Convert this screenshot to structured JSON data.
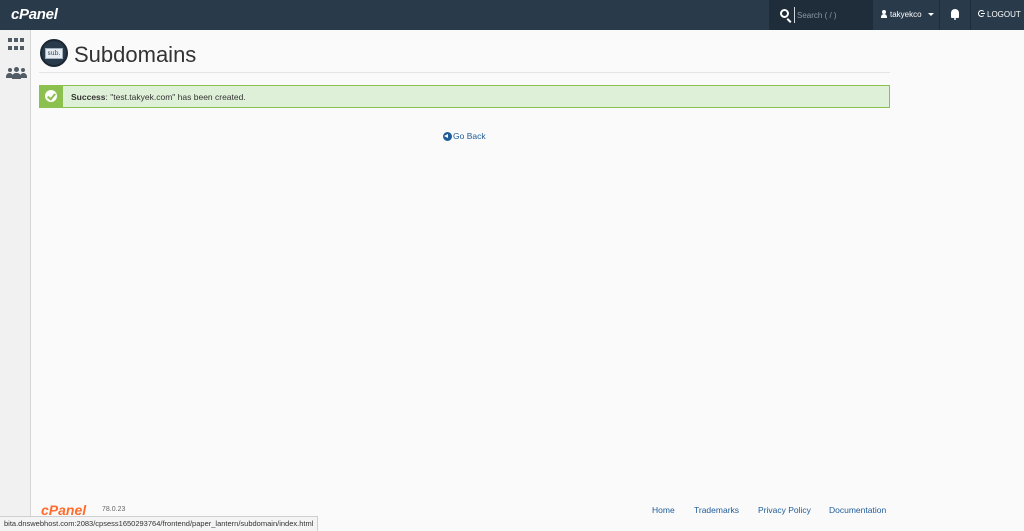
{
  "topbar": {
    "logo": "cPanel",
    "search_placeholder": "Search ( / )",
    "username": "takyekco",
    "logout_label": "LOGOUT"
  },
  "sidebar": {
    "items": [
      {
        "icon": "grid-icon",
        "label": "Home"
      },
      {
        "icon": "users-icon",
        "label": "User Manager"
      }
    ]
  },
  "header": {
    "page_icon_text": "sub.",
    "title": "Subdomains"
  },
  "alert": {
    "type": "success",
    "strong": "Success",
    "message": ": \"test.takyek.com\" has been created.",
    "icon": "check-icon"
  },
  "go_back": {
    "label": "Go Back",
    "icon": "arrow-circle-left-icon"
  },
  "footer": {
    "logo": "cPanel",
    "version": "78.0.23",
    "links": [
      "Home",
      "Trademarks",
      "Privacy Policy",
      "Documentation"
    ]
  },
  "status_bar": {
    "url": "bita.dnswebhost.com:2083/cpsess1650293764/frontend/paper_lantern/subdomain/index.html"
  },
  "colors": {
    "topbar": "#293a4a",
    "accent_orange": "#ff6c2c",
    "success_bg": "#dff0d8",
    "success_border": "#8cc04f",
    "link": "#1f5c99"
  }
}
